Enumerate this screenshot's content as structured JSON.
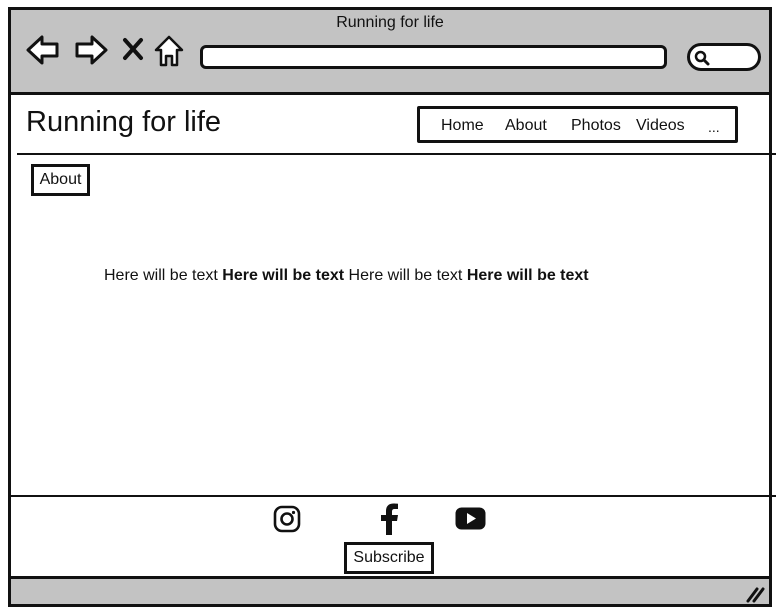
{
  "window": {
    "title": "Running for life"
  },
  "browser": {
    "back_icon": "arrow-left-icon",
    "forward_icon": "arrow-right-icon",
    "close_icon": "close-icon",
    "home_icon": "home-icon",
    "url_value": "",
    "search_icon": "search-icon"
  },
  "site": {
    "title": "Running for life"
  },
  "menu": {
    "items": [
      {
        "label": "Home"
      },
      {
        "label": "About"
      },
      {
        "label": "Photos"
      },
      {
        "label": "Videos"
      },
      {
        "label": "..."
      }
    ]
  },
  "section": {
    "button_label": "About"
  },
  "content": {
    "parts": [
      {
        "text": "Here will be text ",
        "bold": false
      },
      {
        "text": "Here will be text",
        "bold": true
      },
      {
        "text": " Here will be text ",
        "bold": false
      },
      {
        "text": "Here will be text",
        "bold": true
      }
    ]
  },
  "footer": {
    "social_icons": [
      "instagram-icon",
      "facebook-icon",
      "youtube-icon"
    ],
    "subscribe_label": "Subscribe"
  },
  "colors": {
    "chrome": "#c3c3c3",
    "stroke": "#111111",
    "page": "#ffffff"
  }
}
